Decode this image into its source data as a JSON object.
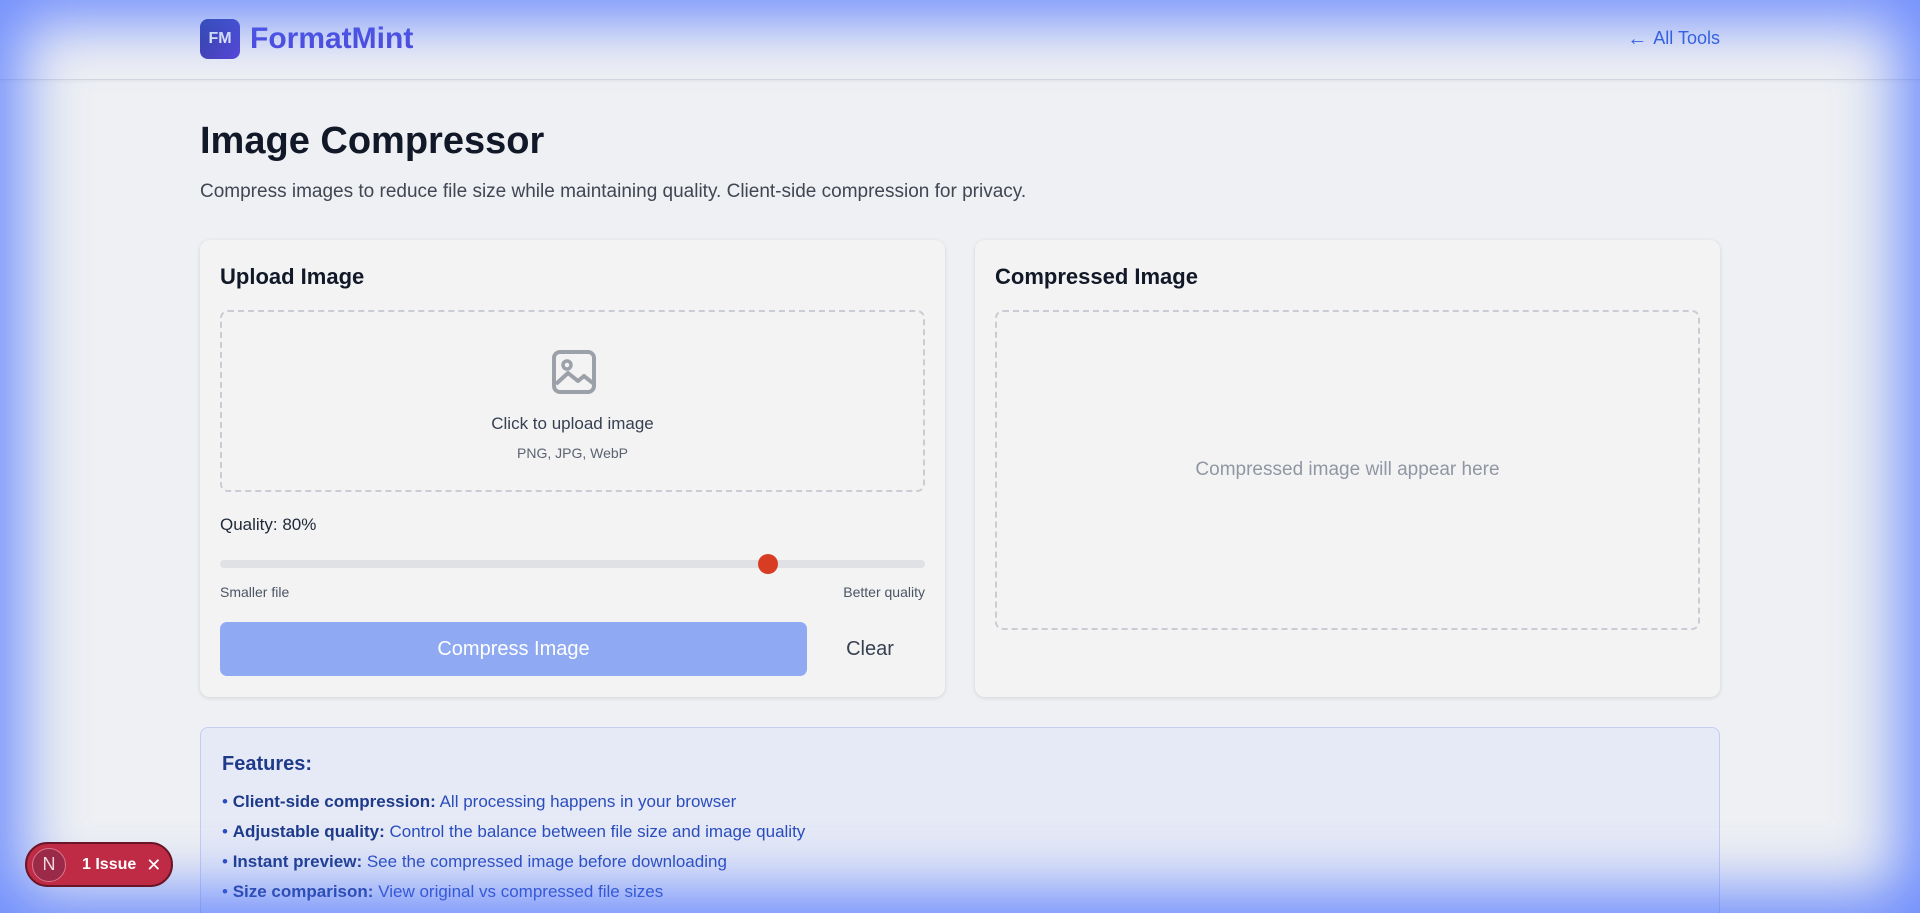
{
  "header": {
    "logo_badge": "FM",
    "brand": "FormatMint",
    "back_link": "All Tools",
    "back_arrow": "←"
  },
  "page": {
    "title": "Image Compressor",
    "subtitle": "Compress images to reduce file size while maintaining quality. Client-side compression for privacy."
  },
  "upload_card": {
    "title": "Upload Image",
    "upload_label": "Click to upload image",
    "upload_formats": "PNG, JPG, WebP",
    "quality_label": "Quality: 80%",
    "quality_value": 80,
    "slider_min_label": "Smaller file",
    "slider_max_label": "Better quality",
    "compress_button": "Compress Image",
    "clear_button": "Clear"
  },
  "result_card": {
    "title": "Compressed Image",
    "placeholder": "Compressed image will appear here"
  },
  "features": {
    "title": "Features:",
    "items": [
      {
        "label": "Client-side compression:",
        "text": "All processing happens in your browser"
      },
      {
        "label": "Adjustable quality:",
        "text": "Control the balance between file size and image quality"
      },
      {
        "label": "Instant preview:",
        "text": "See the compressed image before downloading"
      },
      {
        "label": "Size comparison:",
        "text": "View original vs compressed file sizes"
      }
    ]
  },
  "issue_badge": {
    "avatar": "N",
    "label": "1 Issue",
    "close": "✕"
  },
  "colors": {
    "brand": "#4f4ad9",
    "primary_button": "#8fa9f2",
    "slider_thumb": "#d83d23",
    "issue_badge": "#bf2a45"
  }
}
